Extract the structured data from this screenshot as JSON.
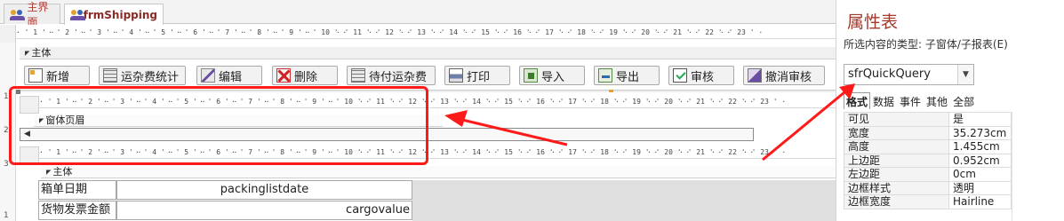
{
  "tabs": [
    {
      "label": "主界面",
      "icon": "form-icon",
      "active": false
    },
    {
      "label": "frmShipping",
      "icon": "form-icon",
      "active": true
    }
  ],
  "ruler_numbers": [
    "1",
    "2",
    "3",
    "4",
    "5",
    "6",
    "7",
    "8",
    "9",
    "10",
    "11",
    "12",
    "13",
    "14",
    "15",
    "16",
    "17",
    "18",
    "19",
    "20",
    "21",
    "22",
    "23"
  ],
  "vruler_numbers": [
    "1",
    "2",
    "3",
    "1"
  ],
  "main_form": {
    "section_main": "主体",
    "toolbar": [
      {
        "label": "新增",
        "icon": "new-record-icon"
      },
      {
        "label": "运杂费统计",
        "icon": "statistics-icon"
      },
      {
        "label": "编辑",
        "icon": "edit-icon"
      },
      {
        "label": "删除",
        "icon": "delete-icon"
      },
      {
        "label": "待付运杂费",
        "icon": "pending-fee-icon"
      },
      {
        "label": "打印",
        "icon": "print-icon"
      },
      {
        "label": "导入",
        "icon": "import-icon"
      },
      {
        "label": "导出",
        "icon": "export-icon"
      },
      {
        "label": "审核",
        "icon": "audit-icon"
      },
      {
        "label": "撤消审核",
        "icon": "undo-audit-icon"
      }
    ]
  },
  "subform": {
    "header_section": "窗体页眉",
    "detail_section": "主体",
    "fields": [
      {
        "label": "箱单日期",
        "value": "packinglistdate"
      },
      {
        "label": "货物发票金额",
        "value": "cargovalue"
      }
    ]
  },
  "property_sheet": {
    "title": "属性表",
    "selection_type": "所选内容的类型: 子窗体/子报表(E)",
    "selected_object": "sfrQuickQuery",
    "tabs": [
      "格式",
      "数据",
      "事件",
      "其他",
      "全部"
    ],
    "active_tab": "格式",
    "properties": [
      {
        "name": "可见",
        "value": "是"
      },
      {
        "name": "宽度",
        "value": "35.273cm"
      },
      {
        "name": "高度",
        "value": "1.455cm"
      },
      {
        "name": "上边距",
        "value": "0.952cm"
      },
      {
        "name": "左边距",
        "value": "0cm"
      },
      {
        "name": "边框样式",
        "value": "透明"
      },
      {
        "name": "边框宽度",
        "value": "Hairline"
      }
    ]
  },
  "colors": {
    "annotation": "#ff1a1a",
    "title": "#a23a2b",
    "tab_text": "#b23a33"
  }
}
